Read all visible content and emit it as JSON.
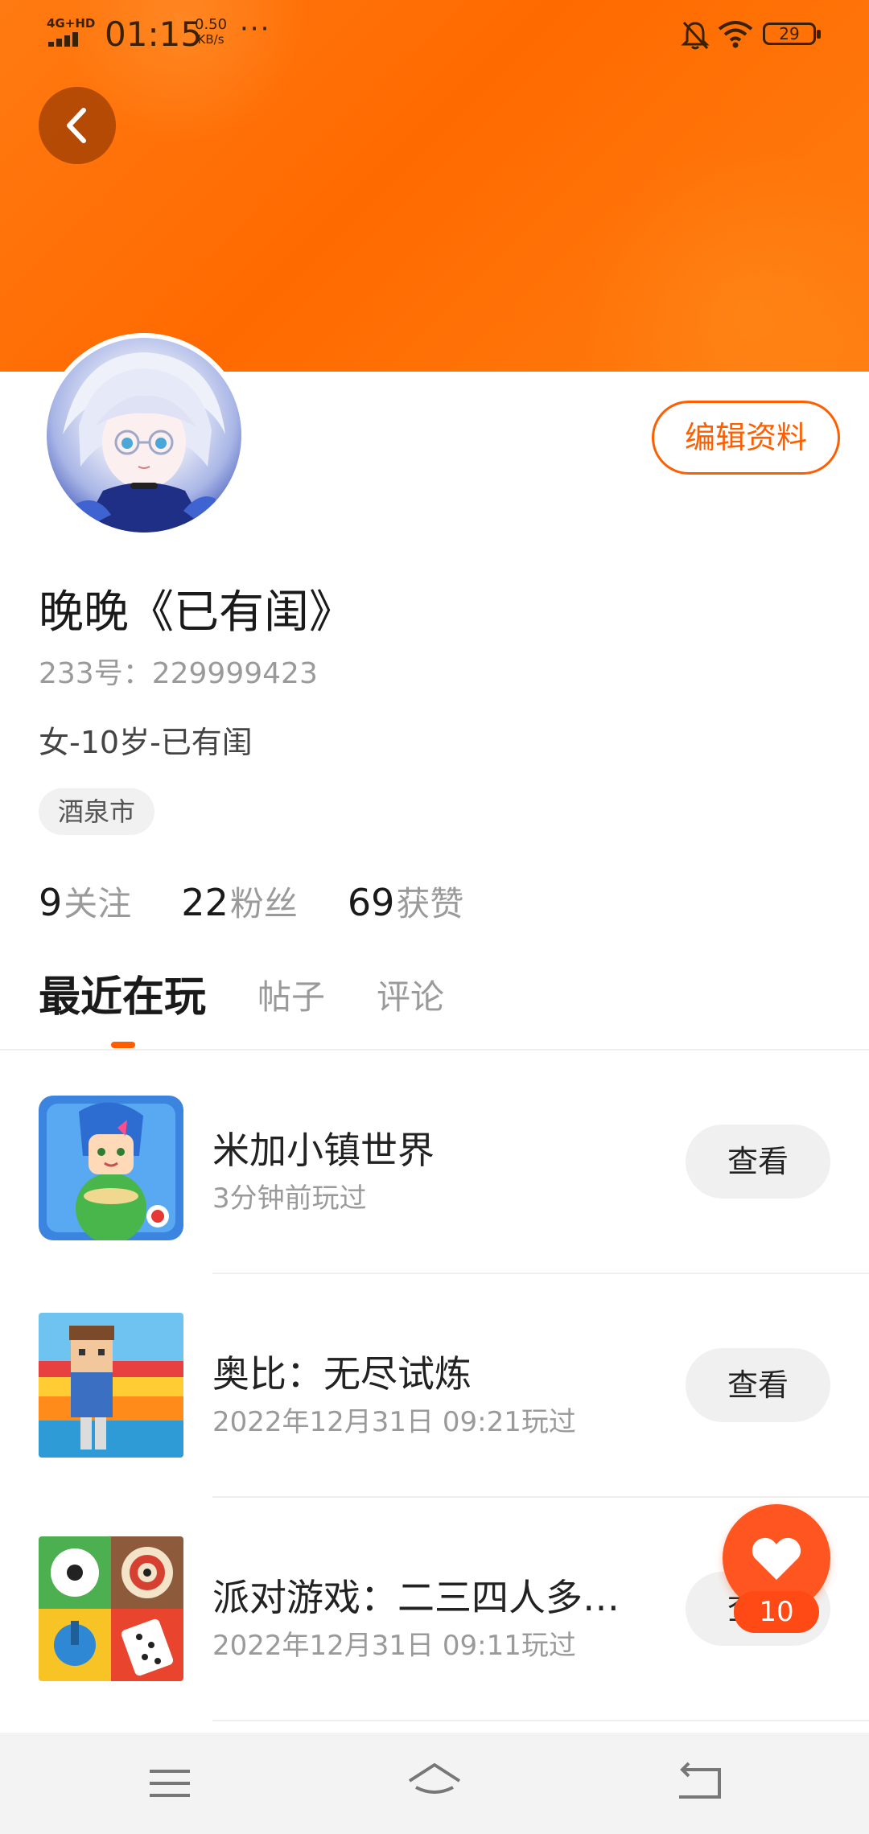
{
  "status_bar": {
    "network": "4G+HD",
    "time": "01:15",
    "speed_value": "0.50",
    "speed_unit": "KB/s",
    "more": "···",
    "battery": "29"
  },
  "profile": {
    "edit_label": "编辑资料",
    "nickname": "晚晚《已有闺》",
    "id_label": "233号：",
    "id_value": "229999423",
    "bio": "女-10岁-已有闺",
    "city": "酒泉市",
    "stats": [
      {
        "count": "9",
        "label": "关注"
      },
      {
        "count": "22",
        "label": "粉丝"
      },
      {
        "count": "69",
        "label": "获赞"
      }
    ]
  },
  "tabs": [
    {
      "label": "最近在玩",
      "active": true
    },
    {
      "label": "帖子",
      "active": false
    },
    {
      "label": "评论",
      "active": false
    }
  ],
  "games": [
    {
      "title": "米加小镇世界",
      "played": "3分钟前玩过",
      "button": "查看"
    },
    {
      "title": "奥比：无尽试炼",
      "played": "2022年12月31日 09:21玩过",
      "button": "查看"
    },
    {
      "title": "派对游戏：二三四人多…",
      "played": "2022年12月31日 09:11玩过",
      "button": "查看"
    }
  ],
  "like": {
    "count": "10"
  },
  "colors": {
    "accent": "#ff5e00",
    "banner": "#ff6a00",
    "fab": "#ff5520"
  },
  "icons": {
    "back": "chevron-left-icon",
    "like": "heart-icon",
    "nav_menu": "menu-icon",
    "nav_home": "home-icon",
    "nav_back": "back-icon"
  }
}
